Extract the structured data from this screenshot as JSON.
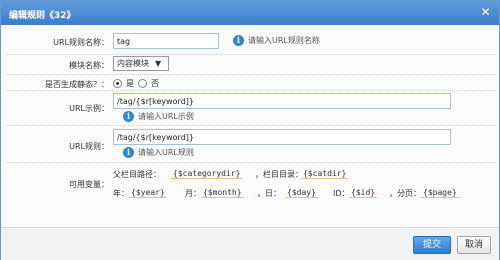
{
  "dialog": {
    "title": "编辑规则《32》",
    "close_symbol": "✕"
  },
  "form": {
    "url_rule_name": {
      "label": "URL规则名称：",
      "value": "tag",
      "hint": "请输入URL规则名称"
    },
    "module": {
      "label": "模块名称：",
      "selected": "内容模块"
    },
    "static": {
      "label": "是否生成静态？：",
      "options": [
        "是",
        "否"
      ],
      "selected": "是"
    },
    "url_example": {
      "label": "URL示例：",
      "value": "/tag/{$r[keyword]}",
      "hint": "请输入URL示例"
    },
    "url_rule": {
      "label": "URL规则：",
      "value": "/tag/{$r[keyword]}",
      "hint": "请输入URL规则"
    },
    "variables": {
      "label": "可用变量：",
      "parent_dir_label": "父栏目路径：",
      "parent_dir_var": "{$categorydir}",
      "cat_dir_label": "，栏目目录：",
      "cat_dir_var": "{$catdir}",
      "year_label": "年：",
      "year_var": "{$year}",
      "month_label": "月：",
      "month_var": "{$month}",
      "day_label": "，日：",
      "day_var": "{$day}",
      "id_label": "ID：",
      "id_var": "{$id}",
      "page_label": "，分页：",
      "page_var": "{$page}"
    }
  },
  "footer": {
    "submit": "提交",
    "cancel": "取消"
  }
}
